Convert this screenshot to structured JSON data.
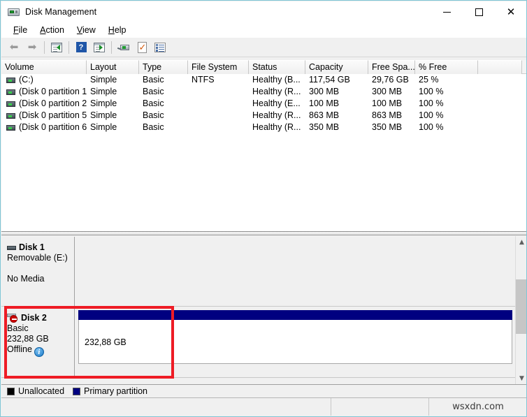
{
  "window": {
    "title": "Disk Management",
    "icon": "disk-drive-icon",
    "minimize_label": "—",
    "maximize_label": "□",
    "close_label": "✕"
  },
  "menu": {
    "items": [
      {
        "label": "File",
        "accel": "F"
      },
      {
        "label": "Action",
        "accel": "A"
      },
      {
        "label": "View",
        "accel": "V"
      },
      {
        "label": "Help",
        "accel": "H"
      }
    ]
  },
  "toolbar": {
    "buttons": [
      {
        "name": "back-arrow-icon",
        "glyph": "←"
      },
      {
        "name": "forward-arrow-icon",
        "glyph": "→"
      },
      {
        "name": "show-hide-console-tree-icon",
        "glyph": ""
      },
      {
        "name": "help-icon",
        "glyph": "?"
      },
      {
        "name": "show-hide-action-pane-icon",
        "glyph": ""
      },
      {
        "name": "rescan-disks-icon",
        "glyph": ""
      },
      {
        "name": "properties-icon",
        "glyph": ""
      },
      {
        "name": "list-view-icon",
        "glyph": ""
      }
    ]
  },
  "volume_list": {
    "columns": [
      {
        "label": "Volume",
        "width": 122
      },
      {
        "label": "Layout",
        "width": 75
      },
      {
        "label": "Type",
        "width": 70
      },
      {
        "label": "File System",
        "width": 87
      },
      {
        "label": "Status",
        "width": 81
      },
      {
        "label": "Capacity",
        "width": 90
      },
      {
        "label": "Free Spa...",
        "width": 67
      },
      {
        "label": "% Free",
        "width": 90
      },
      {
        "label": "",
        "width": 63
      }
    ],
    "rows": [
      {
        "volume": "(C:)",
        "layout": "Simple",
        "type": "Basic",
        "file_system": "NTFS",
        "status": "Healthy (B...",
        "capacity": "117,54 GB",
        "free_space": "29,76 GB",
        "percent_free": "25 %"
      },
      {
        "volume": "(Disk 0 partition 1)",
        "layout": "Simple",
        "type": "Basic",
        "file_system": "",
        "status": "Healthy (R...",
        "capacity": "300 MB",
        "free_space": "300 MB",
        "percent_free": "100 %"
      },
      {
        "volume": "(Disk 0 partition 2)",
        "layout": "Simple",
        "type": "Basic",
        "file_system": "",
        "status": "Healthy (E...",
        "capacity": "100 MB",
        "free_space": "100 MB",
        "percent_free": "100 %"
      },
      {
        "volume": "(Disk 0 partition 5)",
        "layout": "Simple",
        "type": "Basic",
        "file_system": "",
        "status": "Healthy (R...",
        "capacity": "863 MB",
        "free_space": "863 MB",
        "percent_free": "100 %"
      },
      {
        "volume": "(Disk 0 partition 6)",
        "layout": "Simple",
        "type": "Basic",
        "file_system": "",
        "status": "Healthy (R...",
        "capacity": "350 MB",
        "free_space": "350 MB",
        "percent_free": "100 %"
      }
    ]
  },
  "graphical_view": {
    "disks": [
      {
        "name": "Disk 1",
        "line2": "Removable (E:)",
        "line3": "",
        "line4": "No Media",
        "status_icon": "",
        "has_media": false,
        "partition_label": ""
      },
      {
        "name": "Disk 2",
        "line2": "Basic",
        "line3": "232,88 GB",
        "line4": "Offline",
        "status_icon": "info-icon",
        "has_media": true,
        "partition_label": "232,88 GB"
      }
    ],
    "scrollbar": {
      "up_glyph": "▲",
      "down_glyph": "▼"
    }
  },
  "legend": {
    "items": [
      {
        "label": "Unallocated",
        "color": "#000000"
      },
      {
        "label": "Primary partition",
        "color": "#000080"
      }
    ]
  },
  "statusbar": {
    "segment1": "",
    "segment2": "",
    "watermark": "wsxdn.com"
  },
  "colors": {
    "primary_partition": "#000080",
    "unallocated": "#000000",
    "highlight": "#ee1c25",
    "window_border": "#7fc6d6"
  }
}
